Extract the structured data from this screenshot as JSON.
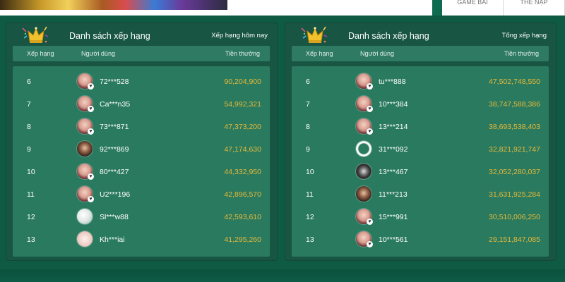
{
  "top_tabs": [
    "GAME BÀI",
    "THẺ NẠP"
  ],
  "panels": [
    {
      "title": "Danh sách xếp hạng",
      "filter": "Xếp hạng hôm nay",
      "columns": {
        "rank": "Xếp hạng",
        "user": "Người dùng",
        "prize": "Tiền thưởng"
      },
      "rows": [
        {
          "rank": "6",
          "user": "72***528",
          "prize": "90,204,900",
          "avatar": ""
        },
        {
          "rank": "7",
          "user": "Ca***n35",
          "prize": "54,992,321",
          "avatar": ""
        },
        {
          "rank": "8",
          "user": "73***871",
          "prize": "47,373,200",
          "avatar": ""
        },
        {
          "rank": "9",
          "user": "92***869",
          "prize": "47,174,630",
          "avatar": "dark"
        },
        {
          "rank": "10",
          "user": "80***427",
          "prize": "44,332,950",
          "avatar": ""
        },
        {
          "rank": "11",
          "user": "U2***196",
          "prize": "42,896,570",
          "avatar": ""
        },
        {
          "rank": "12",
          "user": "Sl***w88",
          "prize": "42,593,610",
          "avatar": "pale"
        },
        {
          "rank": "13",
          "user": "Kh***iai",
          "prize": "41,295,260",
          "avatar": "pink"
        }
      ]
    },
    {
      "title": "Danh sách xếp hạng",
      "filter": "Tổng xếp hạng",
      "columns": {
        "rank": "Xếp hạng",
        "user": "Người dùng",
        "prize": "Tiền thưởng"
      },
      "rows": [
        {
          "rank": "6",
          "user": "tu***888",
          "prize": "47,502,748,550",
          "avatar": ""
        },
        {
          "rank": "7",
          "user": "10***384",
          "prize": "38,747,588,386",
          "avatar": ""
        },
        {
          "rank": "8",
          "user": "13***214",
          "prize": "38,693,538,403",
          "avatar": ""
        },
        {
          "rank": "9",
          "user": "31***092",
          "prize": "32,821,921,747",
          "avatar": "ring"
        },
        {
          "rank": "10",
          "user": "13***467",
          "prize": "32,052,280,037",
          "avatar": "grey"
        },
        {
          "rank": "11",
          "user": "11***213",
          "prize": "31,631,925,284",
          "avatar": "dark"
        },
        {
          "rank": "12",
          "user": "15***991",
          "prize": "30,510,006,250",
          "avatar": ""
        },
        {
          "rank": "13",
          "user": "10***561",
          "prize": "29,151,847,085",
          "avatar": ""
        }
      ]
    }
  ],
  "colors": {
    "background": "#0e5a43",
    "panel": "#185542",
    "table": "#2a7a60",
    "header_row": "#2e7a62",
    "prize": "#e6b938"
  },
  "icons": {
    "panel_header": "crown-icon",
    "avatar_badge": "heart-badge-icon"
  }
}
